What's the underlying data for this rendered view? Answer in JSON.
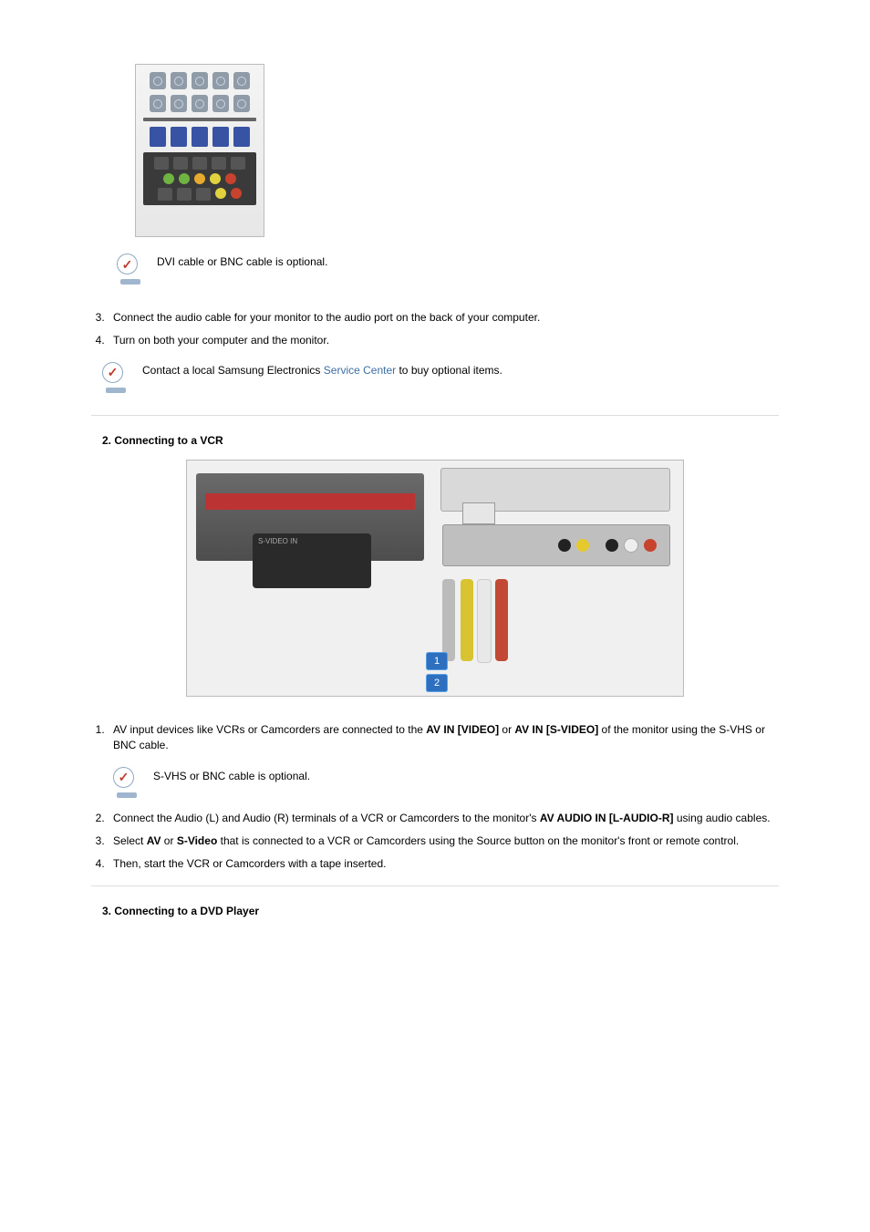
{
  "notes": {
    "dvi_bnc_optional": "DVI cable or BNC cable is optional.",
    "service_center_pre": "Contact a local Samsung Electronics ",
    "service_center_link": "Service Center",
    "service_center_post": " to buy optional items.",
    "svhs_bnc_optional": "S-VHS or BNC cable is optional."
  },
  "list1": {
    "start": 3,
    "items": [
      "Connect the audio cable for your monitor to the audio port on the back of your computer.",
      "Turn on both your computer and the monitor."
    ]
  },
  "section2": {
    "title": "2. Connecting to a VCR"
  },
  "list2": {
    "start": 1,
    "items": [
      {
        "pre": "AV input devices like VCRs or Camcorders are connected to the ",
        "b1": "AV IN [VIDEO]",
        "mid1": " or ",
        "b2": "AV IN [S-VIDEO]",
        "post": " of the monitor using the S-VHS or BNC cable."
      },
      {
        "pre": "Connect the Audio (L) and Audio (R) terminals of a VCR or Camcorders to the monitor's ",
        "b1": "AV AUDIO IN [L-AUDIO-R]",
        "post": " using audio cables."
      },
      {
        "pre": "Select ",
        "b1": "AV",
        "mid1": " or ",
        "b2": "S-Video",
        "post": " that is connected to a VCR or Camcorders using the Source button on the monitor's front or remote control."
      },
      {
        "pre": "Then, start the VCR or Camcorders with a tape inserted."
      }
    ]
  },
  "section3": {
    "title": "3. Connecting to a DVD Player"
  },
  "badges": {
    "one": "1",
    "two": "2"
  }
}
